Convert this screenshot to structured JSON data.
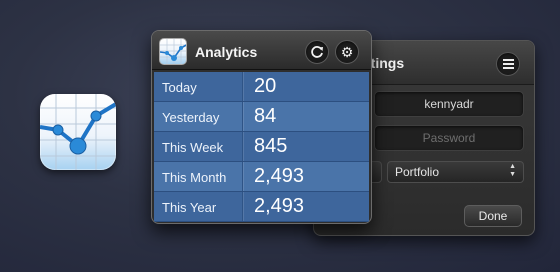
{
  "app_icon": {
    "icon": "analytics-chart-icon"
  },
  "settings_window": {
    "title": "ttings",
    "menu_icon": "list-icon",
    "username_value": "kennyadr",
    "password_placeholder": "Password",
    "portfolio_select": "Portfolio",
    "done_label": "Done"
  },
  "analytics_window": {
    "title": "Analytics",
    "refresh_icon": "refresh-icon",
    "settings_icon": "gear-icon",
    "rows": [
      {
        "label": "Today",
        "value": "20"
      },
      {
        "label": "Yesterday",
        "value": "84"
      },
      {
        "label": "This Week",
        "value": "845"
      },
      {
        "label": "This Month",
        "value": "2,493"
      },
      {
        "label": "This Year",
        "value": "2,493"
      }
    ]
  },
  "colors": {
    "row_dark": "#3e669c",
    "row_light": "#4a74a9",
    "chart_line": "#1f74c6",
    "chart_node": "#2a8ad8"
  }
}
